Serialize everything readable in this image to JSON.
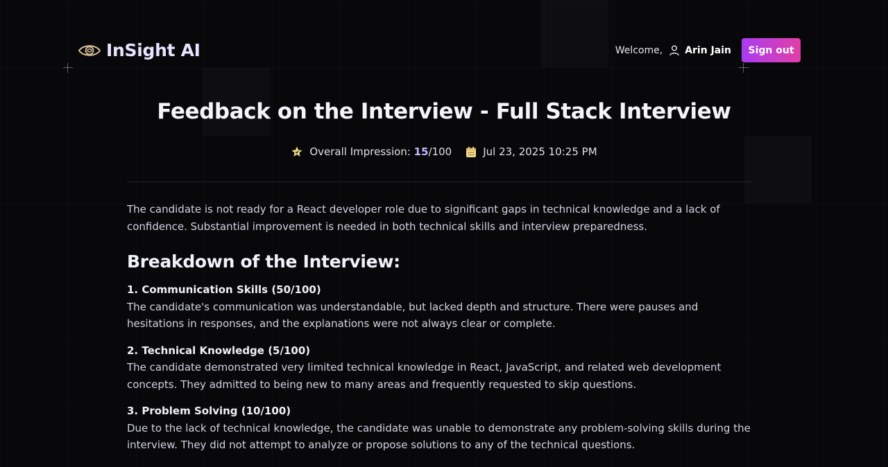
{
  "app": {
    "brand_name": "InSight AI",
    "icons": {
      "logo": "eye-logo-icon",
      "user": "user-icon",
      "star": "star-icon",
      "calendar": "calendar-icon"
    },
    "colors": {
      "accent_start": "#a93cf0",
      "accent_end": "#e23fa7",
      "logo": "#d9c39a",
      "background": "#08080a"
    }
  },
  "header": {
    "welcome": "Welcome,",
    "user_name": "Arin Jain",
    "signout_label": "Sign out"
  },
  "page": {
    "title": "Feedback on the Interview - Full Stack Interview",
    "impression_label": "Overall Impression: ",
    "score": "15",
    "score_max": "/100",
    "date": "Jul 23, 2025 10:25 PM"
  },
  "feedback": {
    "summary": "The candidate is not ready for a React developer role due to significant gaps in technical knowledge and a lack of confidence. Substantial improvement is needed in both technical skills and interview preparedness.",
    "breakdown_title": "Breakdown of the Interview:",
    "categories": [
      {
        "title": "1. Communication Skills (50/100)",
        "description": "The candidate's communication was understandable, but lacked depth and structure. There were pauses and hesitations in responses, and the explanations were not always clear or complete."
      },
      {
        "title": "2. Technical Knowledge (5/100)",
        "description": "The candidate demonstrated very limited technical knowledge in React, JavaScript, and related web development concepts. They admitted to being new to many areas and frequently requested to skip questions."
      },
      {
        "title": "3. Problem Solving (10/100)",
        "description": "Due to the lack of technical knowledge, the candidate was unable to demonstrate any problem-solving skills during the interview. They did not attempt to analyze or propose solutions to any of the technical questions."
      }
    ]
  }
}
